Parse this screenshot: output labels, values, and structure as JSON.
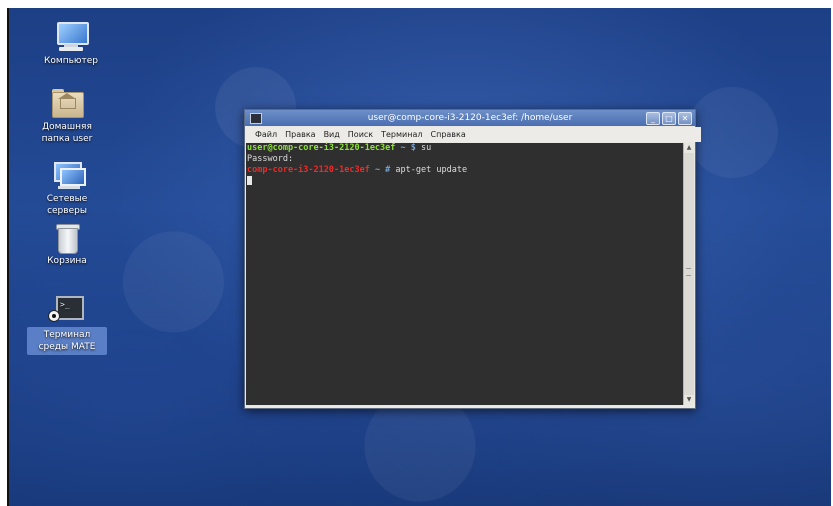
{
  "desktop": {
    "icons": [
      {
        "label": "Компьютер"
      },
      {
        "label": "Домашняя папка user"
      },
      {
        "label": "Сетевые серверы"
      },
      {
        "label": "Корзина"
      },
      {
        "label": "Терминал среды MATE"
      }
    ]
  },
  "window": {
    "title": "user@comp-core-i3-2120-1ec3ef: /home/user",
    "buttons": {
      "minimize": "_",
      "maximize": "□",
      "close": "✕"
    },
    "menu": [
      "Файл",
      "Правка",
      "Вид",
      "Поиск",
      "Терминал",
      "Справка"
    ],
    "terminal": {
      "line1_user": "user@comp-core-i3-2120-1ec3ef",
      "line1_path": " ~ $ ",
      "line1_cmd": "su",
      "line2": "Password:",
      "line3_host": "comp-core-i3-2120-1ec3ef",
      "line3_path": " ~ # ",
      "line3_cmd": "apt-get update"
    },
    "scroll": {
      "up": "▲",
      "down": "▼"
    }
  },
  "colors": {
    "prompt_user": "#8ae234",
    "prompt_root": "#ef2929",
    "path": "#729fcf",
    "selection": "#5b7fc6"
  }
}
